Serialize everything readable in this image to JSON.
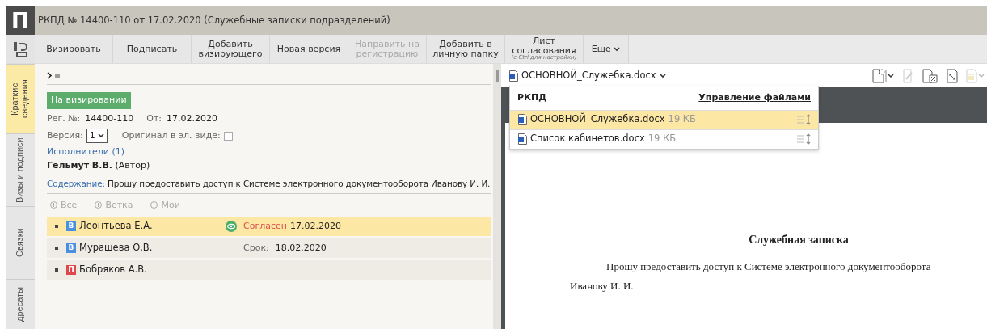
{
  "window": {
    "title": "РКПД №  14400-110 от 17.02.2020 (Служебные записки подразделений)",
    "logo": "П"
  },
  "toolbar": [
    {
      "kind": "button",
      "label": "Визировать",
      "disabled": false
    },
    {
      "kind": "button",
      "label": "Подписать",
      "disabled": false
    },
    {
      "kind": "button",
      "label": "Добавить визирующего",
      "disabled": false
    },
    {
      "kind": "button",
      "label": "Новая версия",
      "disabled": false
    },
    {
      "kind": "button",
      "label": "Направить на регистрацию",
      "disabled": true
    },
    {
      "kind": "button",
      "label": "Добавить в личную папку",
      "disabled": false
    },
    {
      "kind": "button",
      "label": "Лист согласования",
      "hint": "(с Ctrl для настройки)",
      "disabled": false
    },
    {
      "kind": "menu",
      "label": "Еще",
      "disabled": false
    }
  ],
  "side_tabs": [
    {
      "label": "Краткие сведения",
      "selected": true
    },
    {
      "label": "Визы и подписи",
      "selected": false
    },
    {
      "label": "Связки",
      "selected": false
    },
    {
      "label": "дресаты",
      "selected": false
    }
  ],
  "card": {
    "status": "На визировании",
    "reg_label": "Рег. №:",
    "reg_value": "14400-110",
    "from_label": "От:",
    "from_value": "17.02.2020",
    "version_label": "Версия:",
    "version_value": "1",
    "original_label": "Оригинал в эл. виде:",
    "original_checked": false,
    "executors_link": "Исполнители (1)",
    "author": "**Гельмут В.В.** (Автор)",
    "content_label": "Содержание:",
    "content_text": "Прошу предоставить доступ к Системе электронного документооборота Иванову И. И."
  },
  "filters": [
    "Все",
    "Ветка",
    "Мои"
  ],
  "approvers": [
    {
      "kind": "visa",
      "badge": "В",
      "name": "Леонтьева Е.А.",
      "selected": true,
      "viewed": true,
      "status": "Согласен",
      "date": "17.02.2020"
    },
    {
      "kind": "visa",
      "badge": "В",
      "name": "Мурашева О.В.",
      "selected": false,
      "viewed": false,
      "deadline_label": "Срок:",
      "date": "18.02.2020"
    },
    {
      "kind": "sign",
      "badge": "П",
      "name": "Бобряков А.В.",
      "selected": false,
      "viewed": false
    }
  ],
  "viewer": {
    "file": "ОСНОВНОЙ_Служебка.docx",
    "files_panel": {
      "title": "РКПД",
      "manage_link": "Управление файлами",
      "files": [
        {
          "name": "ОСНОВНОЙ_Служебка.docx",
          "size": "19 КБ",
          "selected": true
        },
        {
          "name": "Список кабинетов.docx",
          "size": "19 КБ",
          "selected": false
        }
      ]
    },
    "document": {
      "heading": "Служебная записка",
      "body": "Прошу предоставить доступ к Системе электронного документооборота Иванову И. И."
    }
  }
}
